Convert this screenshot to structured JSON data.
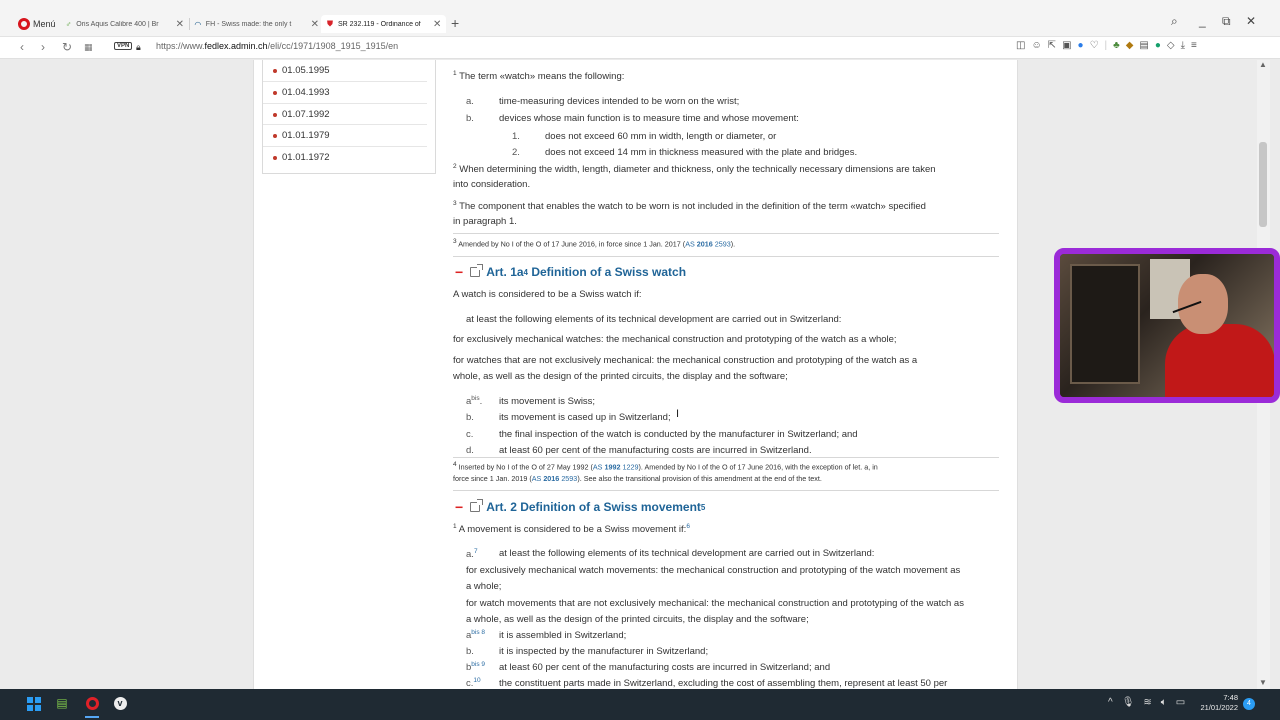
{
  "browser": {
    "menu_label": "Menú",
    "tabs": [
      {
        "title": "Oris Aquis Calibre 400 | Br",
        "favicon": "oris-icon"
      },
      {
        "title": "FH - Swiss made: the only t",
        "favicon": "fh-icon"
      },
      {
        "title": "SR 232.119 - Ordinance of",
        "favicon": "swiss-shield-icon"
      }
    ],
    "new_tab": "+",
    "url_prefix": "https://www.",
    "url_domain": "fedlex.admin.ch",
    "url_path": "/eli/cc/1971/1908_1915_1915/en",
    "vpn_label": "VPN"
  },
  "versions": [
    "01.05.1995",
    "01.04.1993",
    "01.07.1992",
    "01.01.1979",
    "01.01.1972"
  ],
  "article1": {
    "p1": "The term «watch» means the following:",
    "items": [
      {
        "label": "a.",
        "text": "time-measuring devices intended to be worn on the wrist;"
      },
      {
        "label": "b.",
        "text": "devices whose main function is to measure time and whose movement:"
      }
    ],
    "subitems": [
      {
        "label": "1.",
        "text": "does not exceed 60 mm in width, length or diameter, or"
      },
      {
        "label": "2.",
        "text": "does not exceed 14 mm in thickness measured with the plate and bridges."
      }
    ],
    "p2_line1": "When determining the width, length, diameter and thickness, only the technically necessary dimensions are taken",
    "p2_line2": "into consideration.",
    "p3_line1": "The component that enables the watch to be worn is not included in the definition of the term «watch» specified",
    "p3_line2": "in paragraph 1.",
    "footnote3_text": "Amended by No I of the O of 17 June 2016, in force since 1 Jan. 2017 (",
    "footnote3_as": "AS",
    "footnote3_year": "2016",
    "footnote3_page": "2593",
    "footnote3_end": ")."
  },
  "art1a": {
    "heading": "Art. 1a",
    "heading_sup": "4",
    "heading_title": "Definition of a Swiss watch",
    "intro": "A watch is considered to be a Swiss watch if:",
    "line_a": "at least the following elements of its technical development are carried out in Switzerland:",
    "line_mech": "for exclusively mechanical watches: the mechanical construction and prototyping of the watch as a whole;",
    "line_nonmech1": "for watches that are not exclusively mechanical: the mechanical construction and prototyping of the watch as a",
    "line_nonmech2": "whole, as well as the design of the printed circuits, the display and the software;",
    "items": [
      {
        "label": "a",
        "label_sup": "bis",
        "text": "its movement is Swiss;"
      },
      {
        "label": "b.",
        "text": "its movement is cased up in Switzerland;"
      },
      {
        "label": "c.",
        "text": "the final inspection of the watch is conducted by the manufacturer in Switzerland; and"
      },
      {
        "label": "d.",
        "text": "at least 60 per cent of the manufacturing costs are incurred in Switzerland."
      }
    ],
    "footnote4_l1_a": "Inserted by No I of the O of 27 May 1992 (",
    "footnote4_l1_as": "AS",
    "footnote4_l1_year": "1992",
    "footnote4_l1_page": "1229",
    "footnote4_l1_b": "). Amended by No I of the O of 17 June 2016, with the exception of let. a, in",
    "footnote4_l2_a": "force since 1 Jan. 2019 (",
    "footnote4_l2_as": "AS",
    "footnote4_l2_year": "2016",
    "footnote4_l2_page": "2593",
    "footnote4_l2_b": "). See also the transitional provision of this amendment at the end of the text."
  },
  "art2": {
    "heading": "Art. 2 Definition of a Swiss movement",
    "heading_sup": "5",
    "intro": "A movement is considered to be a Swiss movement if:",
    "intro_sup": "6",
    "a_label": "a.",
    "a_sup": "7",
    "a_text": "at least the following elements of its technical development are carried out in Switzerland:",
    "mech1": "for exclusively mechanical watch movements: the mechanical construction and prototyping of the watch movement as",
    "mech2": "a whole;",
    "nonmech1": "for watch movements that are not exclusively mechanical: the mechanical construction and prototyping of the watch as",
    "nonmech2": "a whole, as well as the design of the printed circuits, the display and the software;",
    "items": [
      {
        "label": "a",
        "label_sup": "bis 8",
        "text": "it is assembled in Switzerland;"
      },
      {
        "label": "b.",
        "label_sup": "",
        "text": "it is inspected by the manufacturer in Switzerland;"
      },
      {
        "label": "b",
        "label_sup": "bis 9",
        "text": "at least 60 per cent of the manufacturing costs are incurred in Switzerland; and"
      },
      {
        "label": "c.",
        "label_sup": "10",
        "text": "the constituent parts made in Switzerland, excluding the cost of assembling them, represent at least 50 per"
      }
    ]
  },
  "taskbar": {
    "time": "7:48",
    "date": "21/01/2022",
    "notifications": "4"
  }
}
